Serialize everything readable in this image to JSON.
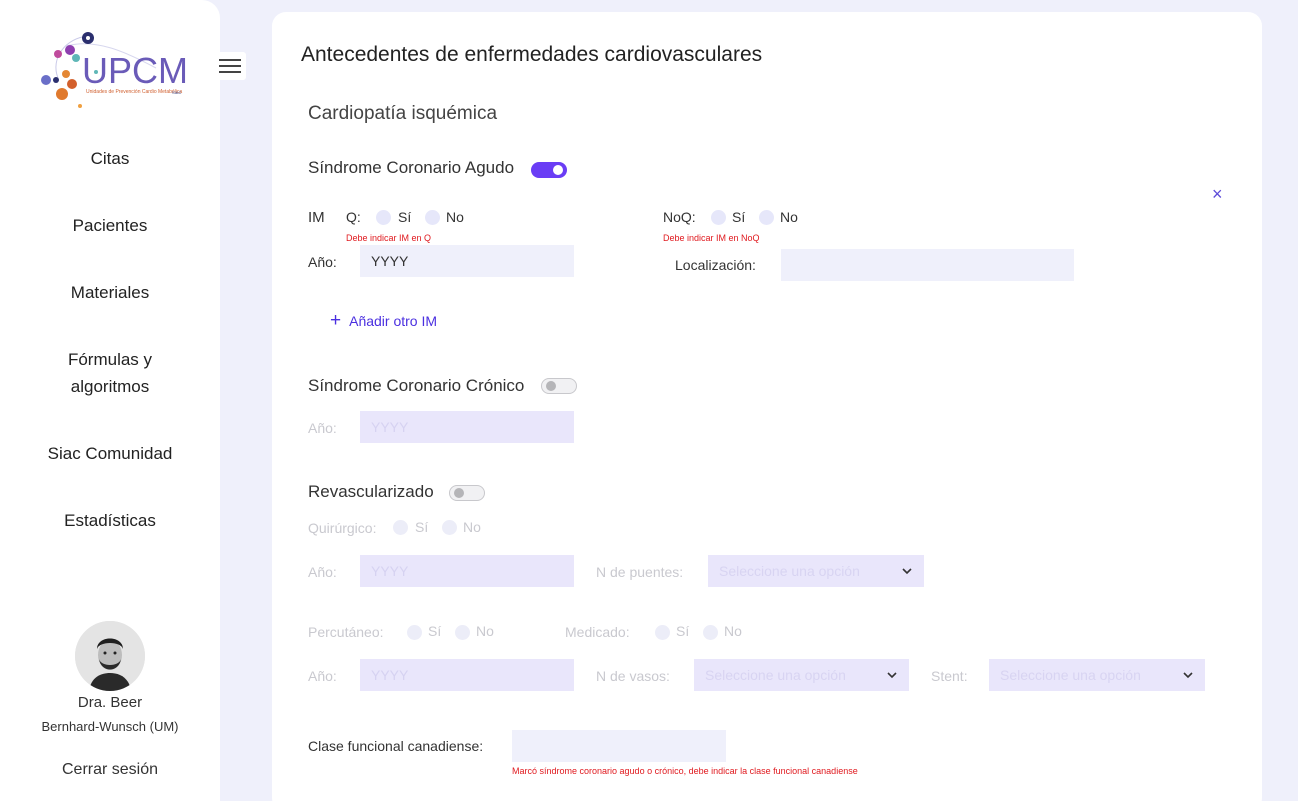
{
  "logo": {
    "text": "UPCM",
    "tagline": "Unidades de Prevención Cardio Metabólica",
    "brand_small": "SIAC"
  },
  "nav": {
    "items": [
      {
        "label": "Citas"
      },
      {
        "label": "Pacientes"
      },
      {
        "label": "Materiales"
      },
      {
        "label": "Fórmulas y"
      },
      {
        "label": "algoritmos"
      },
      {
        "label": "Siac Comunidad"
      },
      {
        "label": "Estadísticas"
      }
    ]
  },
  "user": {
    "name_line1": "Dra. Beer",
    "name_line2": "Bernhard-Wunsch (UM)",
    "logout": "Cerrar sesión"
  },
  "page": {
    "title": "Antecedentes de enfermedades cardiovasculares",
    "subtitle": "Cardiopatía isquémica",
    "close_symbol": "×"
  },
  "sca": {
    "label": "Síndrome Coronario Agudo",
    "toggle_on": true,
    "im_label": "IM",
    "q_label": "Q:",
    "noq_label": "NoQ:",
    "yes": "Sí",
    "no": "No",
    "q_error": "Debe indicar IM en Q",
    "noq_error": "Debe indicar IM en NoQ",
    "year_label": "Año:",
    "year_value": "YYYY",
    "location_label": "Localización:",
    "location_value": "",
    "add_im": "Añadir otro IM"
  },
  "scc": {
    "label": "Síndrome Coronario Crónico",
    "toggle_on": false,
    "year_label": "Año:",
    "year_placeholder": "YYYY"
  },
  "revasc": {
    "label": "Revascularizado",
    "toggle_on": false,
    "surgical_label": "Quirúrgico:",
    "yes": "Sí",
    "no": "No",
    "year_label": "Año:",
    "year_placeholder": "YYYY",
    "bridges_label": "N de puentes:",
    "bridges_select": "Seleccione una opción",
    "percutaneous_label": "Percutáneo:",
    "medicated_label": "Medicado:",
    "year2_label": "Año:",
    "year2_placeholder": "YYYY",
    "vessels_label": "N de vasos:",
    "vessels_select": "Seleccione una opción",
    "stent_label": "Stent:",
    "stent_select": "Seleccione una opción"
  },
  "canadian": {
    "label": "Clase funcional canadiense:",
    "value": "",
    "error": "Marcó síndrome coronario agudo o crónico, debe indicar la clase funcional canadiense"
  },
  "colors": {
    "accent": "#6a3df5",
    "link": "#4a2fe0",
    "error": "#e0191e",
    "background": "#eff0fb"
  }
}
